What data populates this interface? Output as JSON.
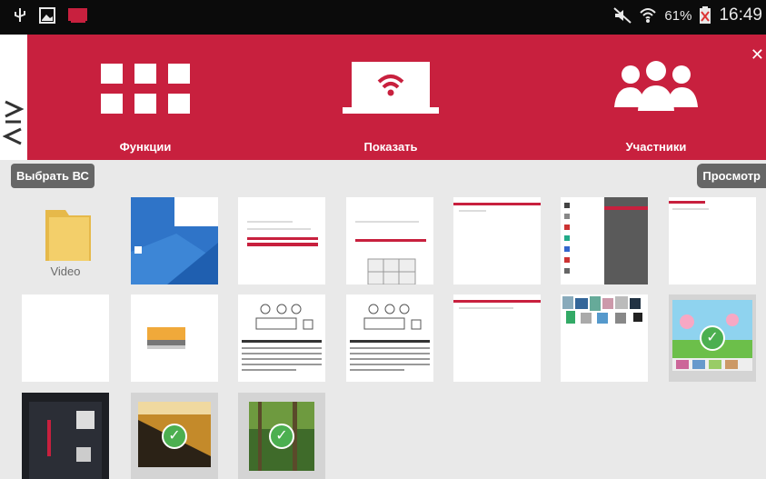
{
  "status_bar": {
    "battery_percent": "61%",
    "time": "16:49",
    "icons": [
      "usb-icon",
      "image-notification-icon",
      "screen-mirror-icon",
      "mute-icon",
      "wifi-icon",
      "battery-low-icon"
    ]
  },
  "logo_text": "VIA",
  "nav": {
    "functions_label": "Функции",
    "show_label": "Показать",
    "participants_label": "Участники",
    "close_icon": "close-icon"
  },
  "actions": {
    "select_bc_label": "Выбрать ВС",
    "preview_label": "Просмотр"
  },
  "gallery": {
    "folder_label": "Video",
    "thumbnails": [
      {
        "type": "folder",
        "selected": false
      },
      {
        "type": "windows-screenshot",
        "selected": false
      },
      {
        "type": "web-form",
        "selected": false
      },
      {
        "type": "web-form-keyboard",
        "selected": false
      },
      {
        "type": "web-page",
        "selected": false
      },
      {
        "type": "phone-menu",
        "selected": false
      },
      {
        "type": "web-page",
        "selected": false
      },
      {
        "type": "blank",
        "selected": false
      },
      {
        "type": "dialog",
        "selected": false
      },
      {
        "type": "diagram-doc",
        "selected": false
      },
      {
        "type": "diagram-doc",
        "selected": false
      },
      {
        "type": "web-page",
        "selected": false
      },
      {
        "type": "photo-collage",
        "selected": false
      },
      {
        "type": "cartoon",
        "selected": true
      },
      {
        "type": "phone-photo",
        "selected": false
      },
      {
        "type": "photo",
        "selected": true
      },
      {
        "type": "forest-photo",
        "selected": true
      }
    ]
  },
  "colors": {
    "header_red": "#c8203e",
    "content_bg": "#e9e9e9",
    "check_green": "#4caf50"
  }
}
